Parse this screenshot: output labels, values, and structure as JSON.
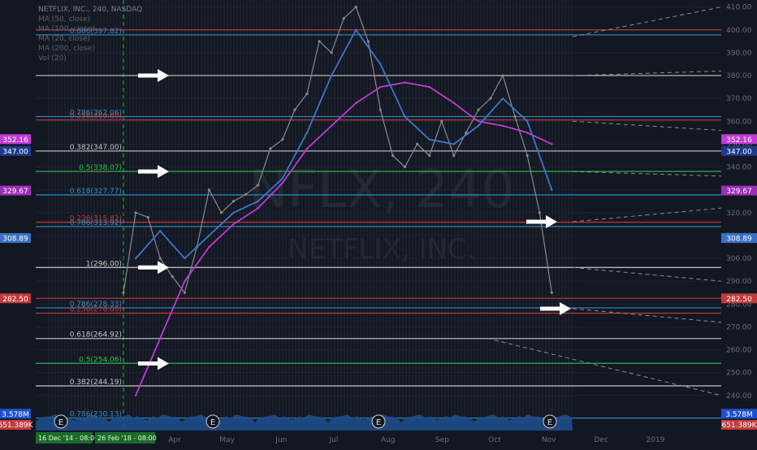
{
  "header": {
    "symbol_line": "NETFLIX, INC., 240, NASDAQ",
    "indicators": [
      "MA (50, close)",
      "MA (100, close)",
      "MA (20, close)",
      "MA (200, close)",
      "Vol (20)"
    ]
  },
  "watermark": {
    "ticker": "NFLX, 240",
    "name": "NETFLIX, INC."
  },
  "colors": {
    "background": "#131722",
    "candle": "#8a8a8a",
    "ma_fast": "#3a78c9",
    "ma_slow": "#c23bd6",
    "ma_mid": "#4b3bd4",
    "red_level": "#c23b3b",
    "blue_level": "#2f8fc4",
    "green_level": "#2fc44a",
    "white_level": "#c8c8c8",
    "volume": "#1f4f8f",
    "arrow": "#ffffff"
  },
  "chart_data": {
    "type": "line",
    "title": "NETFLIX, INC., 240, NASDAQ",
    "xlabel": "",
    "ylabel": "",
    "ylim": [
      225,
      412
    ],
    "y_ticks": [
      240,
      250,
      260,
      270,
      280,
      290,
      300,
      310,
      320,
      330,
      340,
      350,
      360,
      370,
      380,
      390,
      400,
      410
    ],
    "x_ticks": [
      "Apr",
      "May",
      "Jun",
      "Jul",
      "Aug",
      "Sep",
      "Oct",
      "Nov",
      "Dec",
      "2019"
    ],
    "series": [
      {
        "name": "Price",
        "x": [
          "2018-02-26",
          "2018-03-05",
          "2018-03-12",
          "2018-03-19",
          "2018-03-26",
          "2018-04-02",
          "2018-04-09",
          "2018-04-16",
          "2018-04-23",
          "2018-04-30",
          "2018-05-07",
          "2018-05-14",
          "2018-05-21",
          "2018-05-28",
          "2018-06-04",
          "2018-06-11",
          "2018-06-18",
          "2018-06-25",
          "2018-07-02",
          "2018-07-09",
          "2018-07-16",
          "2018-07-23",
          "2018-07-30",
          "2018-08-06",
          "2018-08-13",
          "2018-08-20",
          "2018-08-27",
          "2018-09-03",
          "2018-09-10",
          "2018-09-17",
          "2018-09-24",
          "2018-10-01",
          "2018-10-08",
          "2018-10-15",
          "2018-10-22",
          "2018-10-29"
        ],
        "y": [
          285,
          320,
          318,
          300,
          292,
          285,
          305,
          330,
          320,
          325,
          328,
          332,
          348,
          352,
          365,
          372,
          395,
          390,
          405,
          410,
          395,
          365,
          345,
          340,
          350,
          345,
          360,
          345,
          355,
          365,
          370,
          380,
          362,
          345,
          320,
          285
        ]
      },
      {
        "name": "MA (200, close)",
        "x": [
          "2018-03-05",
          "2018-03-19",
          "2018-04-02",
          "2018-04-16",
          "2018-04-30",
          "2018-05-14",
          "2018-05-28",
          "2018-06-11",
          "2018-06-25",
          "2018-07-09",
          "2018-07-23",
          "2018-08-06",
          "2018-08-20",
          "2018-09-03",
          "2018-09-17",
          "2018-10-01",
          "2018-10-15",
          "2018-10-29"
        ],
        "y": [
          240,
          265,
          290,
          305,
          315,
          322,
          333,
          348,
          358,
          368,
          375,
          377,
          375,
          368,
          360,
          358,
          355,
          350
        ]
      },
      {
        "name": "MA (50, close)",
        "x": [
          "2018-03-05",
          "2018-03-19",
          "2018-04-02",
          "2018-04-16",
          "2018-04-30",
          "2018-05-14",
          "2018-05-28",
          "2018-06-11",
          "2018-06-25",
          "2018-07-09",
          "2018-07-23",
          "2018-08-06",
          "2018-08-20",
          "2018-09-03",
          "2018-09-17",
          "2018-10-01",
          "2018-10-15",
          "2018-10-29"
        ],
        "y": [
          300,
          312,
          300,
          310,
          320,
          325,
          335,
          355,
          380,
          400,
          385,
          362,
          352,
          350,
          358,
          370,
          360,
          330
        ]
      }
    ],
    "levels": [
      {
        "price": 400.0,
        "label": "",
        "color": "red"
      },
      {
        "price": 397.82,
        "label": "0.886(397.82)",
        "color": "blue"
      },
      {
        "price": 380.0,
        "label": "",
        "color": "white"
      },
      {
        "price": 362.06,
        "label": "0.786(362.06)",
        "color": "blue"
      },
      {
        "price": 360.6,
        "label": "0.236(360.60)",
        "color": "red"
      },
      {
        "price": 347.0,
        "label": "0.382(347.00)",
        "color": "white"
      },
      {
        "price": 338.07,
        "label": "0.5(338.07)",
        "color": "green"
      },
      {
        "price": 327.77,
        "label": "0.618(327.77)",
        "color": "blue"
      },
      {
        "price": 315.82,
        "label": "0.236(315.82)",
        "color": "red"
      },
      {
        "price": 313.92,
        "label": "0.786(313.92)",
        "color": "blue"
      },
      {
        "price": 296.0,
        "label": "1(296.00)",
        "color": "white"
      },
      {
        "price": 282.5,
        "label": "",
        "color": "red"
      },
      {
        "price": 278.33,
        "label": "0.786(278.33)",
        "color": "blue"
      },
      {
        "price": 276.0,
        "label": "0.236(276.00)",
        "color": "red"
      },
      {
        "price": 264.92,
        "label": "0.618(264.92)",
        "color": "white"
      },
      {
        "price": 254.06,
        "label": "0.5(254.06)",
        "color": "green"
      },
      {
        "price": 244.19,
        "label": "0.382(244.19)",
        "color": "white"
      },
      {
        "price": 230.13,
        "label": "0.786(230.13)",
        "color": "blue"
      }
    ],
    "right_badges": [
      {
        "price": 352.16,
        "text": "352.16",
        "color": "#c23bd6"
      },
      {
        "price": 347.0,
        "text": "347.00",
        "color": "#1e3a8a"
      },
      {
        "price": 329.67,
        "text": "329.67",
        "color": "#9b2fb8"
      },
      {
        "price": 308.89,
        "text": "308.89",
        "color": "#3b6fc2"
      },
      {
        "price": 282.5,
        "text": "282.50",
        "color": "#c23b3b"
      },
      {
        "price": 232.0,
        "text": "3.578M",
        "color": "#1f4fd1"
      }
    ],
    "left_badges": [
      {
        "price": 352.16,
        "text": "352.16",
        "color": "#c23bd6"
      },
      {
        "price": 347.0,
        "text": "347.00",
        "color": "#1e3a8a"
      },
      {
        "price": 329.67,
        "text": "329.67",
        "color": "#9b2fb8"
      },
      {
        "price": 308.89,
        "text": "308.89",
        "color": "#3b6fc2"
      },
      {
        "price": 282.5,
        "text": "282.50",
        "color": "#c23b3b"
      },
      {
        "price": 232.0,
        "text": "3.578M",
        "color": "#1f4fd1"
      }
    ],
    "volume_readout": "651.389K",
    "bottom_labels": [
      "16 Dec '14 - 08:00",
      "26 Feb '18 - 08:00"
    ],
    "earnings_marker": "E",
    "arrows": [
      {
        "price": 380.0
      },
      {
        "price": 338.0
      },
      {
        "price": 296.0
      },
      {
        "price": 254.0
      },
      {
        "price": 316.0
      },
      {
        "price": 278.0
      }
    ]
  }
}
